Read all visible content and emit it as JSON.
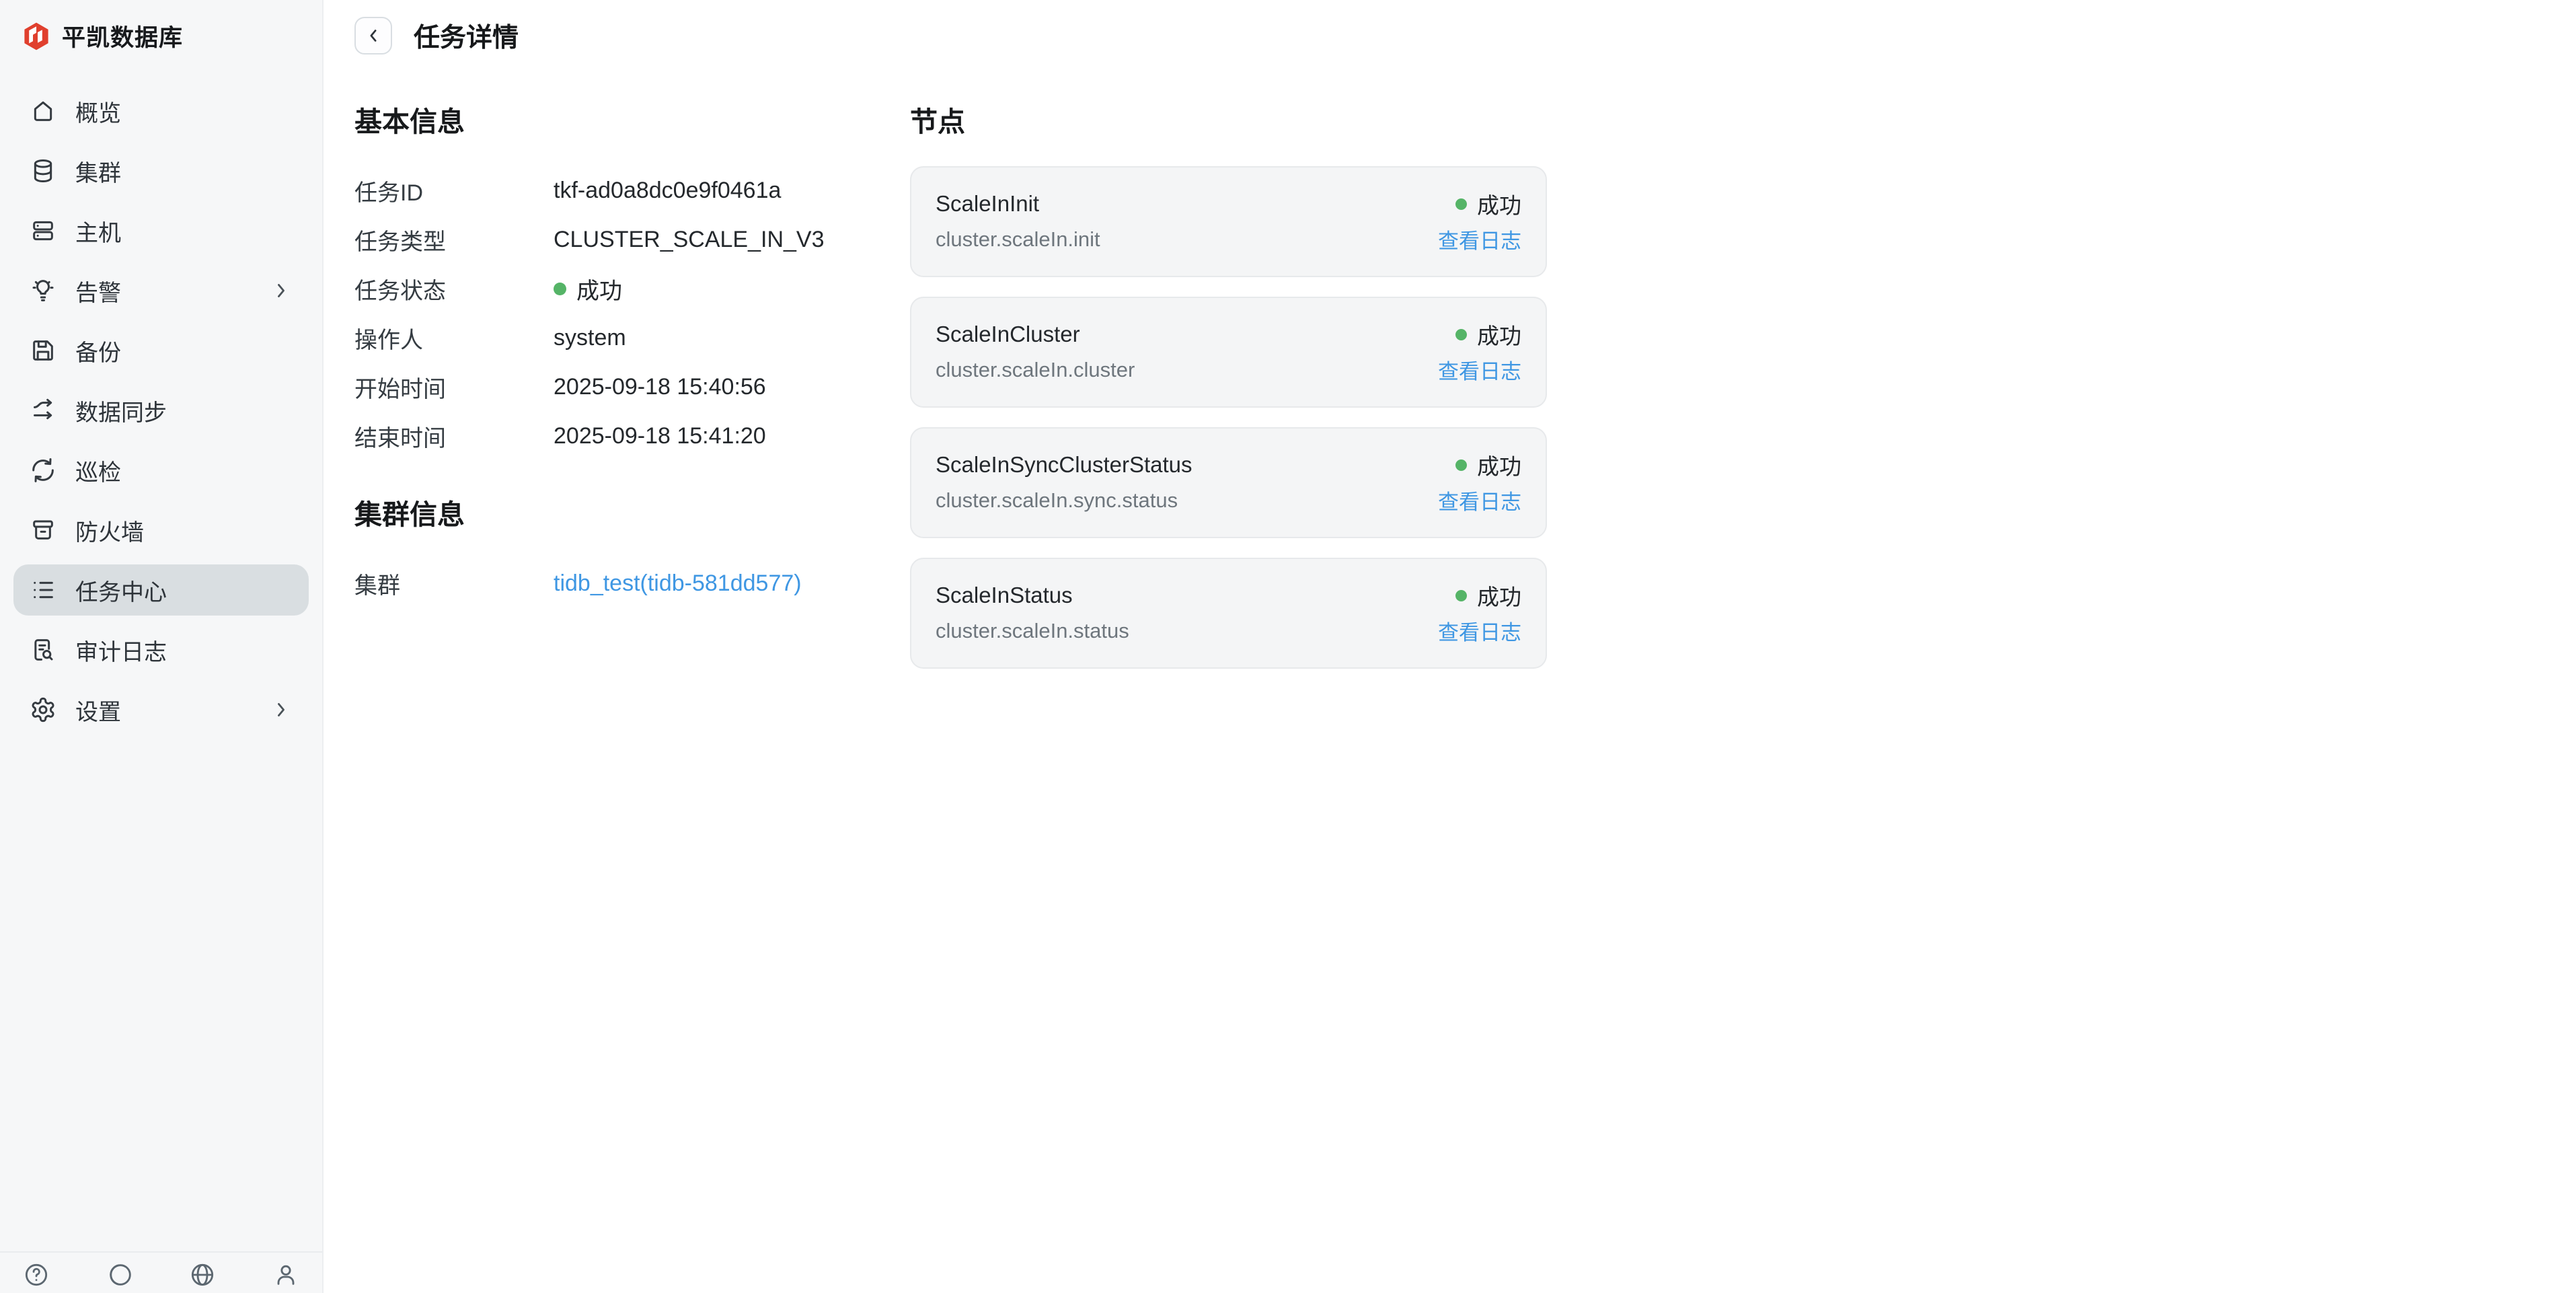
{
  "app": {
    "logo_text": "平凯数据库"
  },
  "sidebar": {
    "items": [
      {
        "key": "overview",
        "label": "概览",
        "icon": "home-icon",
        "active": false,
        "chevron": false
      },
      {
        "key": "clusters",
        "label": "集群",
        "icon": "database-icon",
        "active": false,
        "chevron": false
      },
      {
        "key": "hosts",
        "label": "主机",
        "icon": "server-icon",
        "active": false,
        "chevron": false
      },
      {
        "key": "alerts",
        "label": "告警",
        "icon": "bulb-icon",
        "active": false,
        "chevron": true
      },
      {
        "key": "backup",
        "label": "备份",
        "icon": "save-icon",
        "active": false,
        "chevron": false
      },
      {
        "key": "data-sync",
        "label": "数据同步",
        "icon": "sync-icon",
        "active": false,
        "chevron": false
      },
      {
        "key": "inspection",
        "label": "巡检",
        "icon": "recycle-icon",
        "active": false,
        "chevron": false
      },
      {
        "key": "firewall",
        "label": "防火墙",
        "icon": "archive-icon",
        "active": false,
        "chevron": false
      },
      {
        "key": "task-center",
        "label": "任务中心",
        "icon": "list-icon",
        "active": true,
        "chevron": false
      },
      {
        "key": "audit-logs",
        "label": "审计日志",
        "icon": "doc-search-icon",
        "active": false,
        "chevron": false
      },
      {
        "key": "settings",
        "label": "设置",
        "icon": "gear-icon",
        "active": false,
        "chevron": true
      }
    ],
    "footer_icons": [
      {
        "key": "help",
        "icon": "help-icon"
      },
      {
        "key": "theme",
        "icon": "moon-icon"
      },
      {
        "key": "language",
        "icon": "globe-icon"
      },
      {
        "key": "account",
        "icon": "user-icon"
      }
    ]
  },
  "header": {
    "title": "任务详情"
  },
  "basic_info": {
    "heading": "基本信息",
    "rows": [
      {
        "label": "任务ID",
        "value": "tkf-ad0a8dc0e9f0461a",
        "type": "text"
      },
      {
        "label": "任务类型",
        "value": "CLUSTER_SCALE_IN_V3",
        "type": "text"
      },
      {
        "label": "任务状态",
        "value": "成功",
        "type": "status"
      },
      {
        "label": "操作人",
        "value": "system",
        "type": "text"
      },
      {
        "label": "开始时间",
        "value": "2025-09-18 15:40:56",
        "type": "text"
      },
      {
        "label": "结束时间",
        "value": "2025-09-18 15:41:20",
        "type": "text"
      }
    ]
  },
  "cluster_info": {
    "heading": "集群信息",
    "rows": [
      {
        "label": "集群",
        "value": "tidb_test(tidb-581dd577)",
        "type": "link"
      }
    ]
  },
  "nodes": {
    "heading": "节点",
    "status_label": "成功",
    "log_link_label": "查看日志",
    "cards": [
      {
        "name": "ScaleInInit",
        "task": "cluster.scaleIn.init"
      },
      {
        "name": "ScaleInCluster",
        "task": "cluster.scaleIn.cluster"
      },
      {
        "name": "ScaleInSyncClusterStatus",
        "task": "cluster.scaleIn.sync.status"
      },
      {
        "name": "ScaleInStatus",
        "task": "cluster.scaleIn.status"
      }
    ]
  },
  "colors": {
    "brand_red": "#e0402e",
    "status_green": "#55b467",
    "link_blue": "#3f97e3"
  }
}
